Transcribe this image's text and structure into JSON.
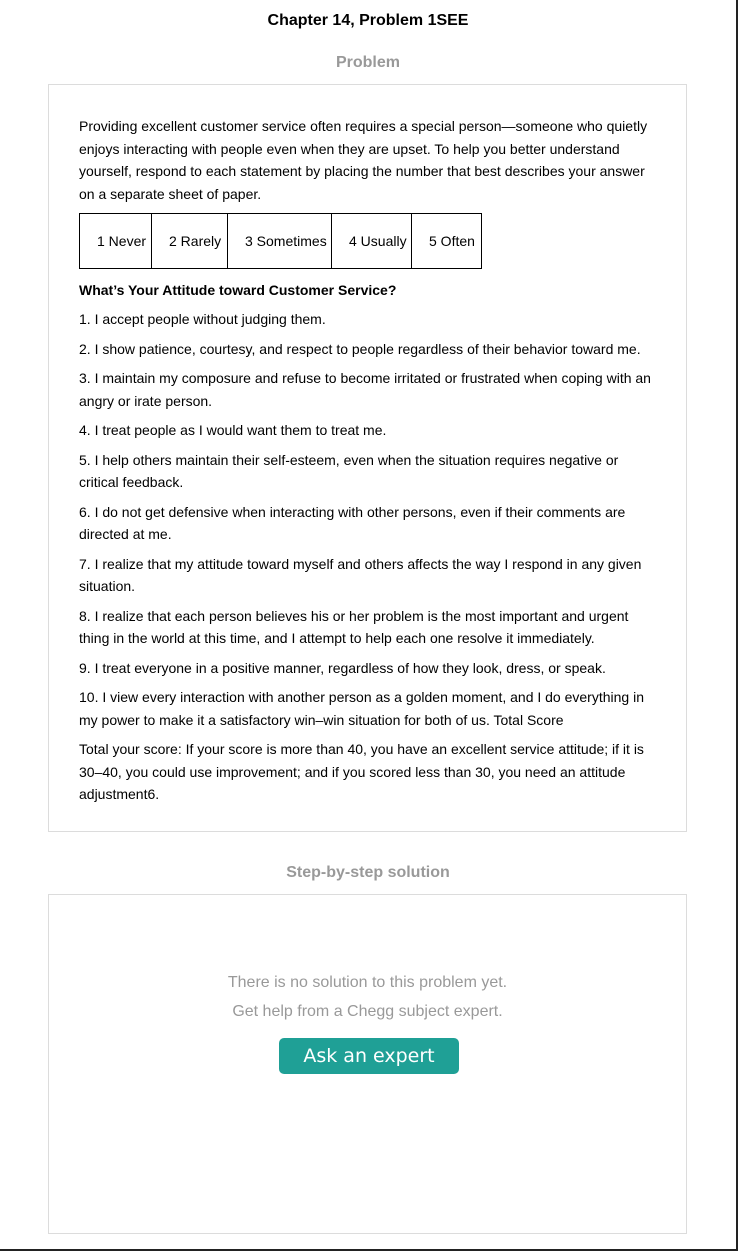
{
  "header": {
    "title": "Chapter 14, Problem 1SEE"
  },
  "problem": {
    "section_label": "Problem",
    "intro": "Providing excellent customer service often requires a special person—someone who quietly enjoys interacting with people even when they are upset. To help you better understand yourself, respond to each statement by placing the number that best describes your answer on a separate sheet of paper.",
    "scale": [
      "1 Never",
      "2 Rarely",
      "3 Sometimes",
      "4 Usually",
      "5 Often"
    ],
    "heading": "What’s Your Attitude toward Customer Service?",
    "items": [
      "1. I accept people without judging them.",
      "2. I show patience, courtesy, and respect to people regardless of their behavior toward me.",
      "3. I maintain my composure and refuse to become irritated or frustrated when coping with an angry or irate person.",
      "4. I treat people as I would want them to treat me.",
      "5. I help others maintain their self-esteem, even when the situation requires negative or critical feedback.",
      "6. I do not get defensive when interacting with other persons, even if their comments are directed at me.",
      "7. I realize that my attitude toward myself and others affects the way I respond in any given situation.",
      "8. I realize that each person believes his or her problem is the most important and urgent thing in the world at this time, and I attempt to help each one resolve it immediately.",
      "9. I treat everyone in a positive manner, regardless of how they look, dress, or speak.",
      "10. I view every interaction with another person as a golden moment, and I do everything in my power to make it a satisfactory win–win situation for both of us. Total Score"
    ],
    "total": "Total your score: If your score is more than 40, you have an excellent service attitude; if it is 30–40, you could use improvement; and if you scored less than 30, you need an attitude adjustment6."
  },
  "solution": {
    "section_label": "Step-by-step solution",
    "no_solution_line1": "There is no solution to this problem yet.",
    "no_solution_line2": "Get help from a Chegg subject expert.",
    "ask_button": "Ask an expert",
    "accent_color": "#1fa096"
  }
}
